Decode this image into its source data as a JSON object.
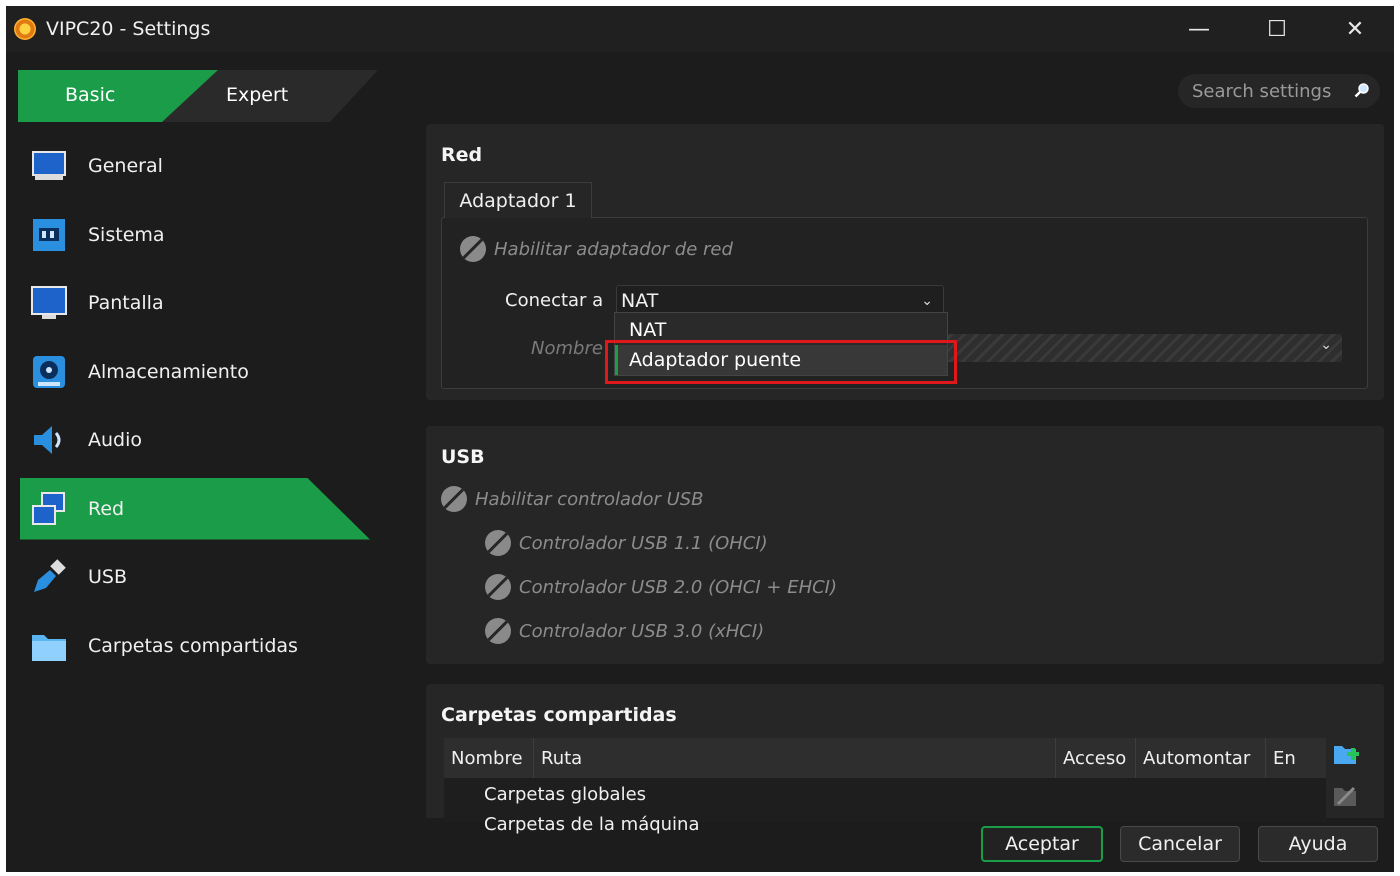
{
  "window": {
    "title": "VIPC20 - Settings",
    "minimize": "—",
    "maximize": "☐",
    "close": "✕"
  },
  "mode_tabs": {
    "basic": "Basic",
    "expert": "Expert"
  },
  "search": {
    "placeholder": "Search settings"
  },
  "sidebar": {
    "items": [
      {
        "label": "General"
      },
      {
        "label": "Sistema"
      },
      {
        "label": "Pantalla"
      },
      {
        "label": "Almacenamiento"
      },
      {
        "label": "Audio"
      },
      {
        "label": "Red",
        "active": true
      },
      {
        "label": "USB"
      },
      {
        "label": "Carpetas compartidas"
      }
    ]
  },
  "network": {
    "title": "Red",
    "adapter_tab": "Adaptador 1",
    "enable_label": "Habilitar adaptador de red",
    "attach_label": "Conectar a",
    "attach_value": "NAT",
    "name_label": "Nombre",
    "dropdown_options": [
      "NAT",
      "Adaptador puente"
    ],
    "highlighted_option": "Adaptador puente"
  },
  "usb": {
    "title": "USB",
    "enable_label": "Habilitar controlador USB",
    "controllers": [
      "Controlador USB 1.1 (OHCI)",
      "Controlador USB 2.0 (OHCI + EHCI)",
      "Controlador USB 3.0 (xHCI)"
    ]
  },
  "shared": {
    "title": "Carpetas compartidas",
    "columns": [
      "Nombre",
      "Ruta",
      "Acceso",
      "Automontar",
      "En"
    ],
    "rows": [
      "Carpetas globales",
      "Carpetas de la máquina"
    ]
  },
  "buttons": {
    "ok": "Aceptar",
    "cancel": "Cancelar",
    "help": "Ayuda"
  },
  "colors": {
    "accent": "#1a9c48",
    "highlight_border": "#e0181c",
    "background": "#1c1c1c"
  }
}
